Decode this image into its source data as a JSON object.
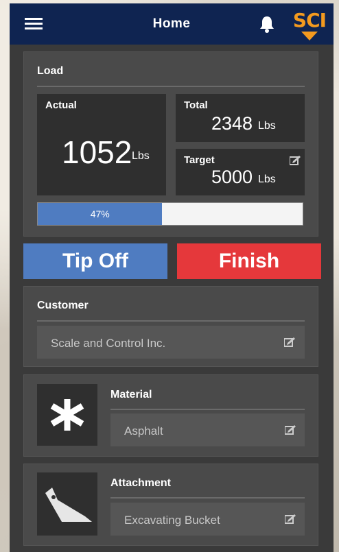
{
  "header": {
    "title": "Home",
    "logo_text": "SCI",
    "brand_color": "#0f2451",
    "logo_color": "#f39a1f"
  },
  "load": {
    "label": "Load",
    "actual": {
      "label": "Actual",
      "value": "1052",
      "unit": "Lbs"
    },
    "total": {
      "label": "Total",
      "value": "2348",
      "unit": "Lbs"
    },
    "target": {
      "label": "Target",
      "value": "5000",
      "unit": "Lbs"
    },
    "progress": {
      "percent": 47,
      "label": "47%"
    }
  },
  "actions": {
    "tip_off": "Tip Off",
    "finish": "Finish",
    "tip_color": "#4f7cc1",
    "finish_color": "#e5383b"
  },
  "customer": {
    "label": "Customer",
    "value": "Scale and Control Inc."
  },
  "material": {
    "label": "Material",
    "value": "Asphalt",
    "icon": "asterisk-icon"
  },
  "attachment": {
    "label": "Attachment",
    "value": "Excavating Bucket",
    "icon": "bucket-icon"
  }
}
